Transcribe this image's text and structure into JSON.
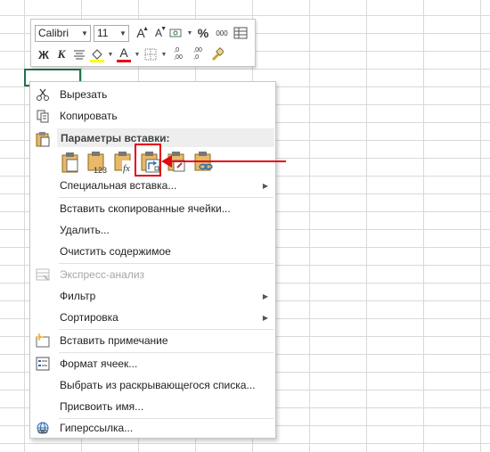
{
  "toolbar": {
    "font_name": "Calibri",
    "font_size": "11",
    "increase_font": "A",
    "decrease_font": "A",
    "percent": "%",
    "thousands": "000",
    "bold": "Ж",
    "italic": "К",
    "font_color_letter": "А",
    "inc_decimal": ",0\n,00",
    "dec_decimal": ",00\n,0",
    "fill_color": "#ffff00",
    "font_color": "#e30613"
  },
  "menu": {
    "cut": "Вырезать",
    "copy": "Копировать",
    "paste_options_header": "Параметры вставки:",
    "paste_special": "Специальная вставка...",
    "insert_copied_cells": "Вставить скопированные ячейки...",
    "delete": "Удалить...",
    "clear_contents": "Очистить содержимое",
    "quick_analysis": "Экспресс-анализ",
    "filter": "Фильтр",
    "sort": "Сортировка",
    "insert_comment": "Вставить примечание",
    "format_cells": "Формат ячеек...",
    "pick_from_list": "Выбрать из раскрывающегося списка...",
    "define_name": "Присвоить имя...",
    "hyperlink": "Гиперссылка...",
    "paste_icons": [
      "paste-icon",
      "paste-values-icon",
      "paste-formulas-icon",
      "paste-transpose-icon",
      "paste-formatting-icon",
      "paste-link-icon"
    ],
    "paste_labels": [
      "123",
      "fx"
    ]
  },
  "annotation": {
    "color": "#e30613",
    "highlighted_option": "paste-transpose-icon"
  }
}
